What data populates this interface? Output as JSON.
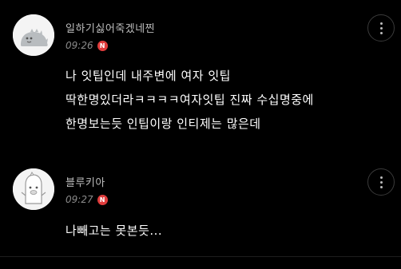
{
  "theme": {
    "background": "#000000",
    "badge_color": "#e03c3c"
  },
  "comments": [
    {
      "nickname": "일하기싫어죽겠네찐",
      "time": "09:26",
      "badge": "N",
      "lines": [
        "나 잇팁인데 내주변에 여자 잇팁",
        "딱한명있더라ㅋㅋㅋㅋ여자잇팁 진짜 수십명중에",
        "한명보는듯 인팁이랑 인티제는 많은데"
      ],
      "avatar_icon": "gray-dinosaur-avatar-icon",
      "more_icon": "more-vertical-icon"
    },
    {
      "nickname": "블루키아",
      "time": "09:27",
      "badge": "N",
      "lines": [
        "나빼고는 못본듯..."
      ],
      "avatar_icon": "white-ghost-avatar-icon",
      "more_icon": "more-vertical-icon"
    }
  ]
}
